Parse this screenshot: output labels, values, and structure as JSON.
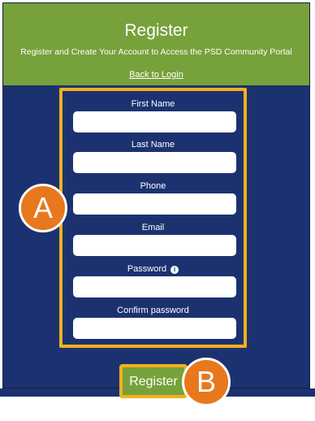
{
  "header": {
    "title": "Register",
    "subtitle": "Register and Create Your Account to Access the PSD Community Portal",
    "back_link": "Back to Login"
  },
  "form": {
    "fields": [
      {
        "label": "First Name",
        "value": ""
      },
      {
        "label": "Last Name",
        "value": ""
      },
      {
        "label": "Phone",
        "value": ""
      },
      {
        "label": "Email",
        "value": ""
      },
      {
        "label": "Password",
        "value": "",
        "icon": "info-icon"
      },
      {
        "label": "Confirm password",
        "value": ""
      }
    ]
  },
  "register_button": "Register",
  "callouts": {
    "a": "A",
    "b": "B"
  },
  "colors": {
    "header_green": "#77a13b",
    "panel_navy": "#1c3270",
    "highlight_yellow": "#f2b01e",
    "callout_orange": "#e8781d"
  }
}
